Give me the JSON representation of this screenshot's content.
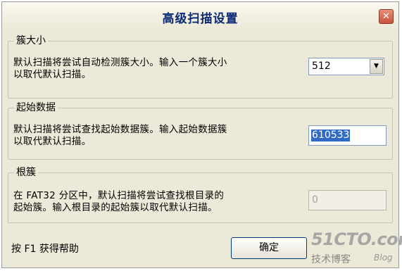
{
  "dialog": {
    "title": "高级扫描设置",
    "close_symbol": "✕"
  },
  "cluster_size": {
    "legend": "簇大小",
    "description": "默认扫描将尝试自动检测簇大小。输入一个簇大小\n以取代默认扫描。",
    "selected_value": "512"
  },
  "start_data": {
    "legend": "起始数据",
    "description": "默认扫描将尝试查找起始数据簇。输入起始数据簇\n以取代默认扫描。",
    "value": "610533"
  },
  "root_cluster": {
    "legend": "根簇",
    "description": "在 FAT32 分区中，默认扫描将尝试查找根目录的\n起始簇。输入根目录的起始簇以取代默认扫描。",
    "value": "0"
  },
  "footer": {
    "help_text": "按 F1 获得帮助",
    "ok_label": "确定"
  },
  "watermark": {
    "logo": "51CTO.com",
    "subtitle": "技术博客",
    "blog": "Blog"
  }
}
